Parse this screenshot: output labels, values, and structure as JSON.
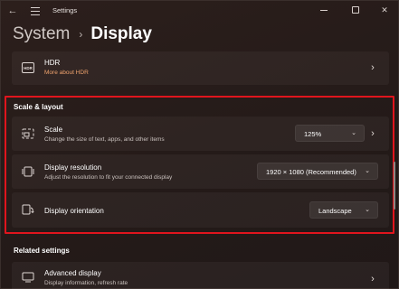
{
  "window": {
    "title": "Settings",
    "controls": {
      "minimize": "minimize",
      "maximize": "maximize",
      "close": "✕"
    }
  },
  "breadcrumb": {
    "parent": "System",
    "separator": "›",
    "current": "Display"
  },
  "hdr": {
    "title": "HDR",
    "link": "More about HDR",
    "icon": "hdr-icon"
  },
  "scale_layout": {
    "heading": "Scale & layout",
    "scale": {
      "title": "Scale",
      "description": "Change the size of text, apps, and other items",
      "value": "125%",
      "icon": "scale-icon"
    },
    "resolution": {
      "title": "Display resolution",
      "description": "Adjust the resolution to fit your connected display",
      "value": "1920 × 1080 (Recommended)",
      "icon": "resolution-icon"
    },
    "orientation": {
      "title": "Display orientation",
      "value": "Landscape",
      "icon": "orientation-icon"
    }
  },
  "related": {
    "heading": "Related settings",
    "advanced": {
      "title": "Advanced display",
      "description": "Display information, refresh rate",
      "icon": "monitor-icon"
    }
  },
  "colors": {
    "highlight": "#e0151d",
    "link": "#f0a36e"
  }
}
